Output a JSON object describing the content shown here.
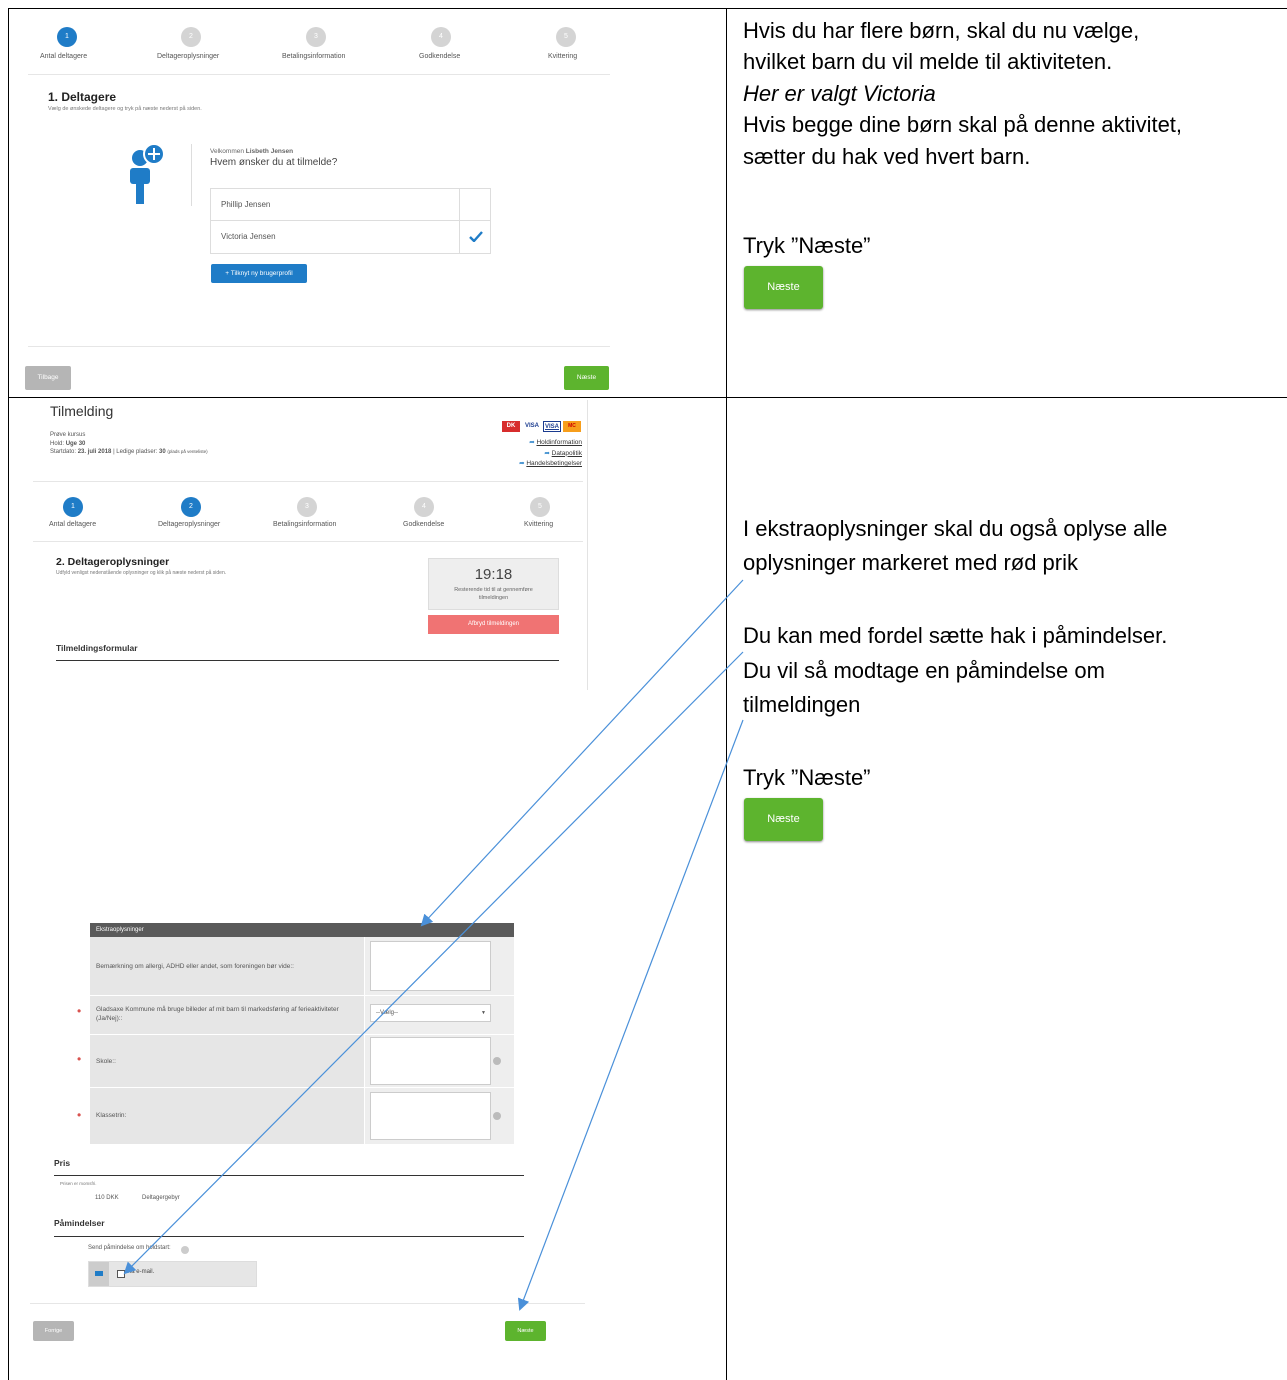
{
  "panel1": {
    "steps": [
      "Antal deltagere",
      "Deltageroplysninger",
      "Betalingsinformation",
      "Godkendelse",
      "Kvittering"
    ],
    "step_numbers": [
      "1",
      "2",
      "3",
      "4",
      "5"
    ],
    "heading": "1. Deltagere",
    "subtext": "Vælg de ønskede deltagere og tryk på næste nederst på siden.",
    "welcome_prefix": "Velkommen",
    "welcome_name": "Lisbeth Jensen",
    "question": "Hvem ønsker du at tilmelde?",
    "participants": [
      {
        "name": "Phillip Jensen",
        "checked": false
      },
      {
        "name": "Victoria Jensen",
        "checked": true
      }
    ],
    "add_profile": "+ Tilknyt ny brugerprofil",
    "back": "Tilbage",
    "next": "Næste"
  },
  "right1": {
    "line1": "Hvis du har flere børn, skal du nu vælge,",
    "line2": "hvilket barn du vil melde til aktiviteten.",
    "line3": "Her er valgt Victoria",
    "line4": "Hvis begge dine børn skal på denne aktivitet,",
    "line5": "sætter du hak ved hvert barn.",
    "press": "Tryk ”Næste”",
    "button": "Næste"
  },
  "panel2": {
    "title": "Tilmelding",
    "course_line": "Prøve kursus",
    "hold_label": "Hold:",
    "hold_value": "Uge 30",
    "start_label": "Startdato:",
    "start_value": "23. juli 2018",
    "seats_label": "| Ledige pladser:",
    "seats_value": "30",
    "seats_note": "(plads på venteliste)",
    "links": [
      "Holdinformation",
      "Datapolitik",
      "Handelsbetingelser"
    ],
    "card_logos": [
      "DK",
      "VISA",
      "VISA",
      "MC"
    ],
    "steps": [
      "Antal deltagere",
      "Deltageroplysninger",
      "Betalingsinformation",
      "Godkendelse",
      "Kvittering"
    ],
    "step_numbers": [
      "1",
      "2",
      "3",
      "4",
      "5"
    ],
    "heading": "2. Deltageroplysninger",
    "subtext": "Udfyld venligst nedenstående oplysninger og klik på næste nederst på siden.",
    "timer": "19:18",
    "timer_text": "Resterende tid til at gennemføre tilmeldingen",
    "cancel": "Afbryd tilmeldingen",
    "form_title": "Tilmeldingsformular",
    "extra_header": "Ekstraoplysninger",
    "fields": [
      {
        "label": "Bemærkning om allergi, ADHD eller andet, som foreningen bør vide::",
        "required": false
      },
      {
        "label": "Gladsaxe Kommune må bruge billeder af mit barn til markedsføring af ferieaktiviteter (Ja/Nej)::",
        "required": true,
        "select": "--Vælg--"
      },
      {
        "label": "Skole::",
        "required": true
      },
      {
        "label": "Klassetrin:",
        "required": true
      }
    ],
    "price_title": "Pris",
    "price_note": "Prisen er momsfri.",
    "price_amount": "110 DKK",
    "price_desc": "Deltagergebyr",
    "reminder_title": "Påmindelser",
    "reminder_text": "Send påmindelse om holdstart:",
    "reminder_option": "Via e-mail.",
    "prev": "Forrige",
    "next": "Næste"
  },
  "right2": {
    "line1": "I ekstraoplysninger skal du også oplyse alle",
    "line2": "oplysninger markeret med rød prik",
    "line3": "Du kan med fordel sætte hak i påmindelser.",
    "line4": "Du vil så modtage en påmindelse om",
    "line5": "tilmeldingen",
    "press": "Tryk ”Næste”",
    "button": "Næste"
  },
  "colors": {
    "accent_blue": "#1f7cc7",
    "green": "#5db42e",
    "red": "#f07373",
    "arrow": "#4a90d9"
  }
}
